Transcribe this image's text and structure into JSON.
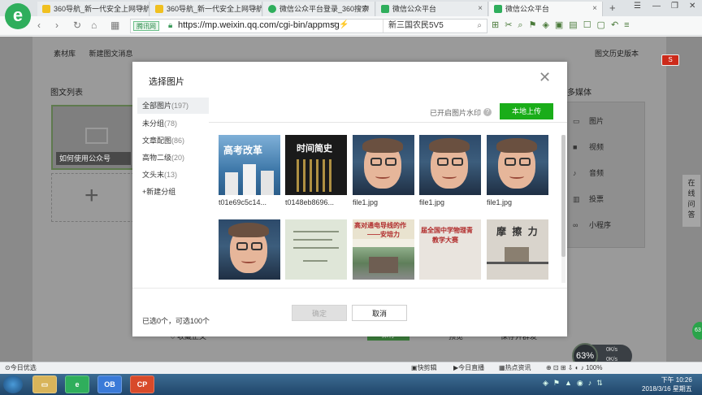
{
  "browser": {
    "logo": "e",
    "tabs": [
      {
        "title": "360导航_新一代安全上网导航",
        "icon_color": "#f0c020"
      },
      {
        "title": "360导航_新一代安全上网导航",
        "icon_color": "#f0c020"
      },
      {
        "title": "微信公众平台登录_360搜索",
        "icon_color": "#2fae5c"
      },
      {
        "title": "微信公众平台",
        "icon_color": "#2fae5c"
      },
      {
        "title": "微信公众平台",
        "icon_color": "#2fae5c",
        "active": true
      }
    ],
    "safe_badge": "腾讯网",
    "url": "https://mp.weixin.qq.com/cgi-bin/appmsg",
    "search_value": "新三国农民5V5"
  },
  "page": {
    "breadcrumb": [
      "素材库",
      "新建图文消息"
    ],
    "history_link": "图文历史版本",
    "list_title": "图文列表",
    "article_caption": "如何使用公众号",
    "media_title": "多媒体",
    "media_items": [
      "图片",
      "视频",
      "音频",
      "投票",
      "小程序"
    ],
    "side_float": [
      "在",
      "线",
      "问",
      "答"
    ],
    "bottom_actions": [
      "预览",
      "保存并群发"
    ],
    "save_label": "保存",
    "bottom_left": "收藏正文"
  },
  "modal": {
    "title": "选择图片",
    "groups": [
      {
        "name": "全部图片",
        "count": "(197)"
      },
      {
        "name": "未分组",
        "count": "(78)"
      },
      {
        "name": "文章配图",
        "count": "(86)"
      },
      {
        "name": "高物二级",
        "count": "(20)"
      },
      {
        "name": "文头末",
        "count": "(13)"
      }
    ],
    "new_group": "+新建分组",
    "watermark_label": "已开启图片水印",
    "upload_label": "本地上传",
    "images": [
      {
        "name": "t01e69c5c14...",
        "kind": "book1",
        "cover_text": "高考改革"
      },
      {
        "name": "t0148eb8696...",
        "kind": "book2",
        "cover_text": "时间简史"
      },
      {
        "name": "file1.jpg",
        "kind": "face"
      },
      {
        "name": "file1.jpg",
        "kind": "face"
      },
      {
        "name": "file1.jpg",
        "kind": "face"
      },
      {
        "name": "",
        "kind": "face"
      },
      {
        "name": "",
        "kind": "doc"
      },
      {
        "name": "",
        "kind": "slide",
        "cover_text": "高对通电导线的作",
        "cover_text2": "——安培力"
      },
      {
        "name": "",
        "kind": "sign",
        "cover_text": "届全国中学物理青",
        "cover_text2": "教学大赛"
      },
      {
        "name": "",
        "kind": "friction",
        "cover_text": "摩 擦 力"
      }
    ],
    "selected_info": "已选0个，可选100个",
    "confirm_label": "确定",
    "cancel_label": "取消"
  },
  "statusbar": {
    "left": "今日优选",
    "items": [
      "快剪辑",
      "今日直播",
      "热点资讯"
    ]
  },
  "speed_widget": {
    "percent": "63%",
    "up": "0K/s",
    "down": "0K/s"
  },
  "taskbar": {
    "apps": [
      "",
      "",
      "OB",
      "CP"
    ],
    "time": "下午 10:26",
    "date": "2018/3/16 星期五"
  },
  "colors": {
    "primary_green": "#1aad19",
    "overlay": "#8a8a8a"
  }
}
